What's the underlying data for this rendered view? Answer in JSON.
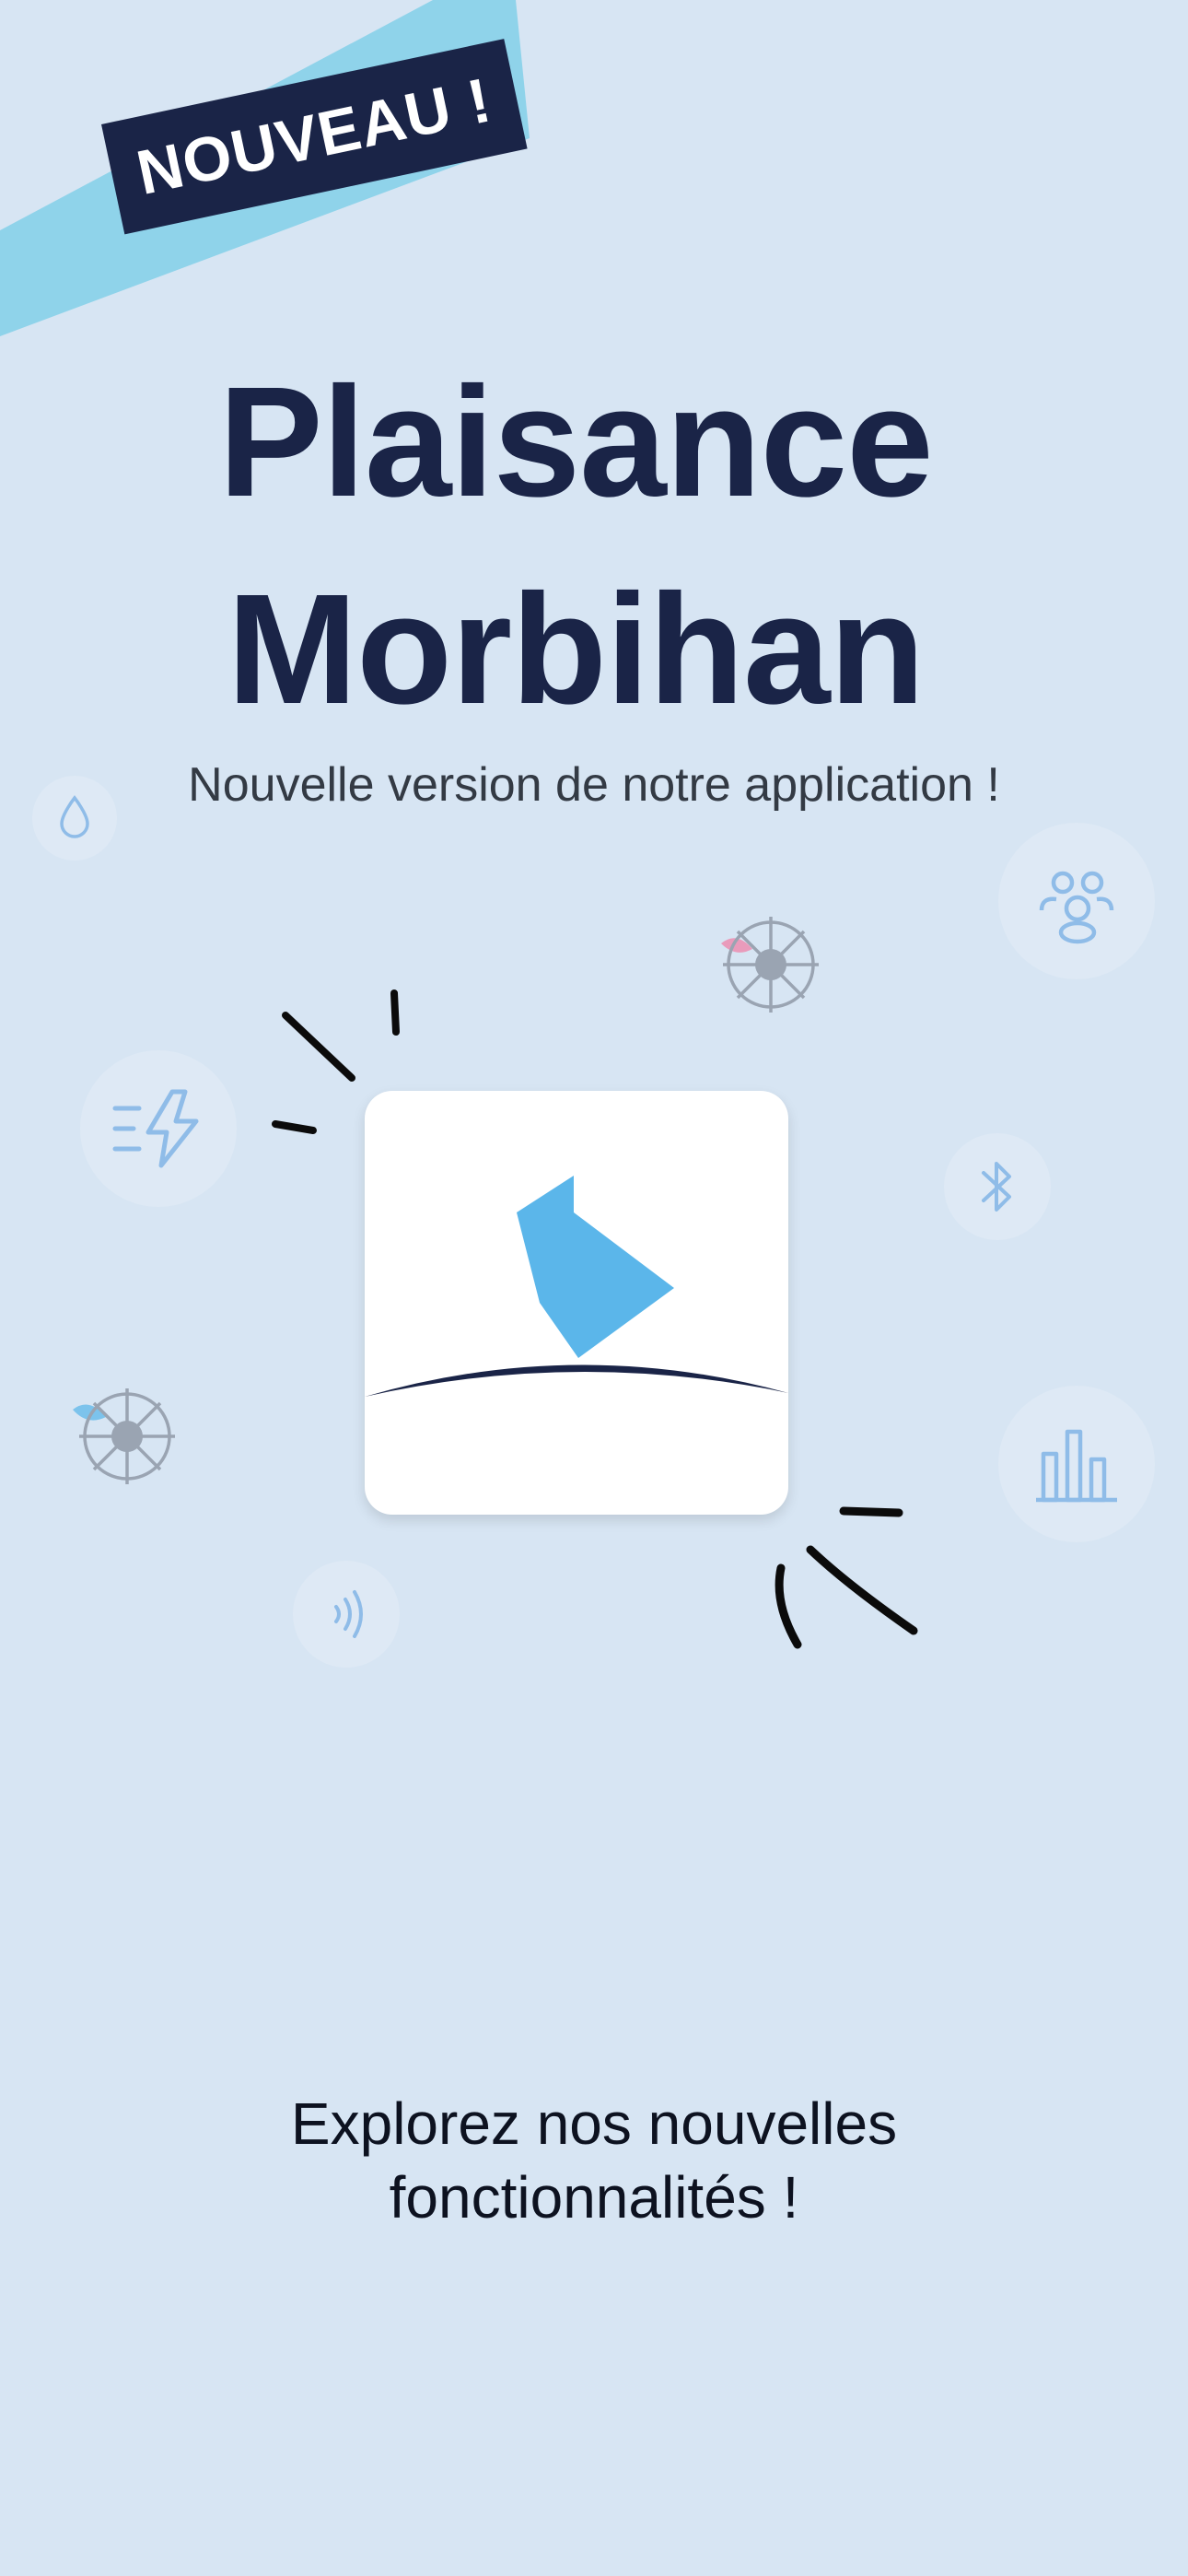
{
  "badge": {
    "label": "NOUVEAU !"
  },
  "title": {
    "line1": "Plaisance",
    "line2": "Morbihan"
  },
  "subtitle": "Nouvelle version de notre application !",
  "cta": {
    "line1": "Explorez nos nouvelles",
    "line2": "fonctionnalités !"
  },
  "icons": [
    "water-drop-icon",
    "group-icon",
    "ship-wheel-icon",
    "fast-charge-icon",
    "bluetooth-icon",
    "bar-chart-icon",
    "nfc-icon"
  ],
  "colors": {
    "background": "#d7e5f3",
    "navy": "#1a2447",
    "ribbon": "#8fd3ea",
    "accent_blue": "#5bb6ea",
    "icon_blue": "#8fbce8"
  }
}
